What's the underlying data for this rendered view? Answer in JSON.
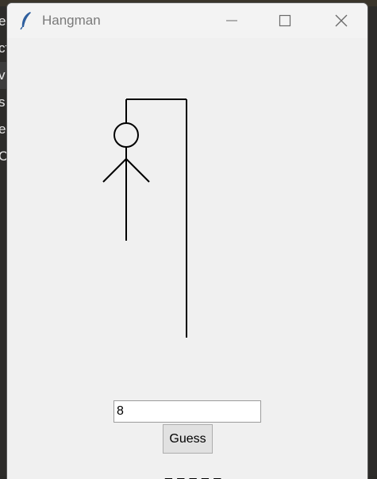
{
  "window": {
    "title": "Hangman",
    "icon": "feather-icon"
  },
  "background_app": {
    "letters": [
      "e",
      "cf",
      "v",
      "s",
      "e",
      "C"
    ]
  },
  "game": {
    "guess_value": "8",
    "guess_button_label": "Guess",
    "word_display": "_ _ _ _ _",
    "hangman_parts_shown": [
      "gallows",
      "head",
      "body",
      "left-arm",
      "right-arm"
    ]
  },
  "colors": {
    "window_bg": "#f0f0f0",
    "drawing_stroke": "#000000"
  }
}
